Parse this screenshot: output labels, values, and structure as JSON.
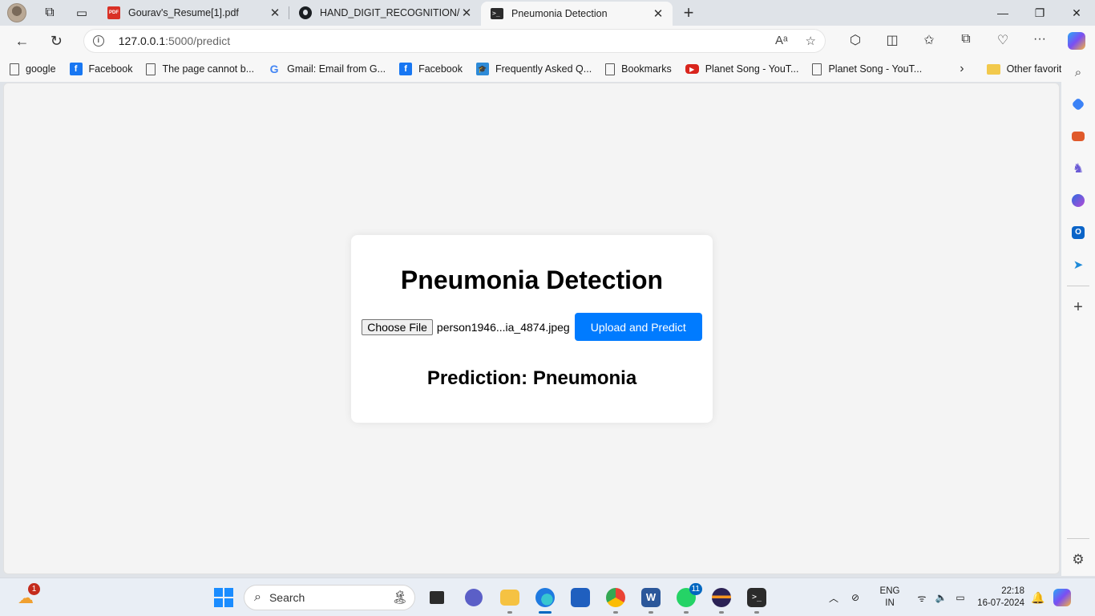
{
  "browser": {
    "tabs": [
      {
        "title": "Gourav's_Resume[1].pdf",
        "icon": "pdf-icon",
        "active": false
      },
      {
        "title": "HAND_DIGIT_RECOGNITION/Pro",
        "icon": "github-icon",
        "active": false
      },
      {
        "title": "Pneumonia Detection",
        "icon": "terminal-icon",
        "active": true
      }
    ],
    "url_host": "127.0.0.1",
    "url_path": ":5000/predict",
    "bookmarks": [
      {
        "label": "google",
        "icon": "page-icon"
      },
      {
        "label": "Facebook",
        "icon": "facebook-icon"
      },
      {
        "label": "The page cannot b...",
        "icon": "page-icon"
      },
      {
        "label": "Gmail: Email from G...",
        "icon": "google-icon"
      },
      {
        "label": "Facebook",
        "icon": "facebook-icon"
      },
      {
        "label": "Frequently Asked Q...",
        "icon": "faq-icon"
      },
      {
        "label": "Bookmarks",
        "icon": "page-icon"
      },
      {
        "label": "Planet Song - YouT...",
        "icon": "youtube-icon"
      },
      {
        "label": "Planet Song - YouT...",
        "icon": "page-icon"
      }
    ],
    "other_favorites": "Other favorites"
  },
  "page": {
    "title": "Pneumonia Detection",
    "choose_file_label": "Choose File",
    "file_name": "person1946...ia_4874.jpeg",
    "submit_label": "Upload and Predict",
    "prediction_text": "Prediction: Pneumonia",
    "accent_color": "#007bff"
  },
  "taskbar": {
    "search_placeholder": "Search",
    "widgets_badge": "1",
    "whatsapp_badge": "11",
    "language_line1": "ENG",
    "language_line2": "IN",
    "time": "22:18",
    "date": "16-07-2024"
  }
}
